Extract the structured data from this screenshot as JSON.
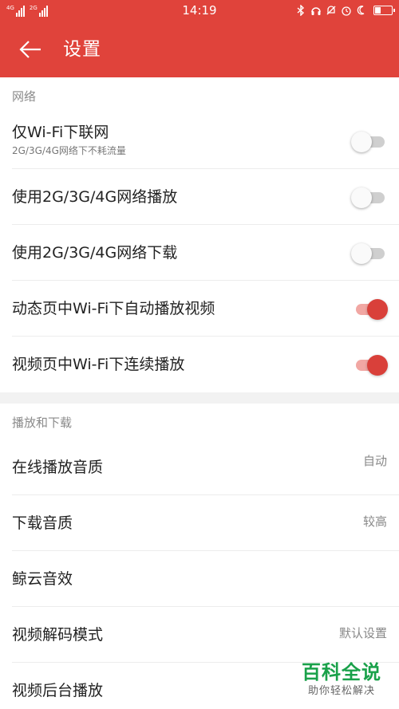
{
  "status_bar": {
    "time": "14:19",
    "signal1_tag": "4G",
    "signal2_tag": "2G",
    "icons": [
      "bluetooth-icon",
      "headset-icon",
      "mute-icon",
      "alarm-icon",
      "moon-icon",
      "battery-icon"
    ]
  },
  "app_bar": {
    "title": "设置"
  },
  "sections": {
    "network": {
      "header": "网络",
      "rows": [
        {
          "label": "仅Wi-Fi下联网",
          "sub": "2G/3G/4G网络下不耗流量",
          "on": false
        },
        {
          "label": "使用2G/3G/4G网络播放",
          "on": false
        },
        {
          "label": "使用2G/3G/4G网络下载",
          "on": false
        },
        {
          "label": "动态页中Wi-Fi下自动播放视频",
          "on": true
        },
        {
          "label": "视频页中Wi-Fi下连续播放",
          "on": true
        }
      ]
    },
    "playback": {
      "header": "播放和下载",
      "rows": [
        {
          "label": "在线播放音质",
          "value": "自动"
        },
        {
          "label": "下载音质",
          "value": "较高"
        },
        {
          "label": "鲸云音效"
        },
        {
          "label": "视频解码模式",
          "value": "默认设置"
        },
        {
          "label": "视频后台播放"
        }
      ]
    }
  },
  "watermark": {
    "title": "百科全说",
    "subtitle": "助你轻松解决"
  },
  "colors": {
    "accent": "#e0433b",
    "toggle_on": "#d9403a",
    "watermark": "#1aa14a"
  }
}
